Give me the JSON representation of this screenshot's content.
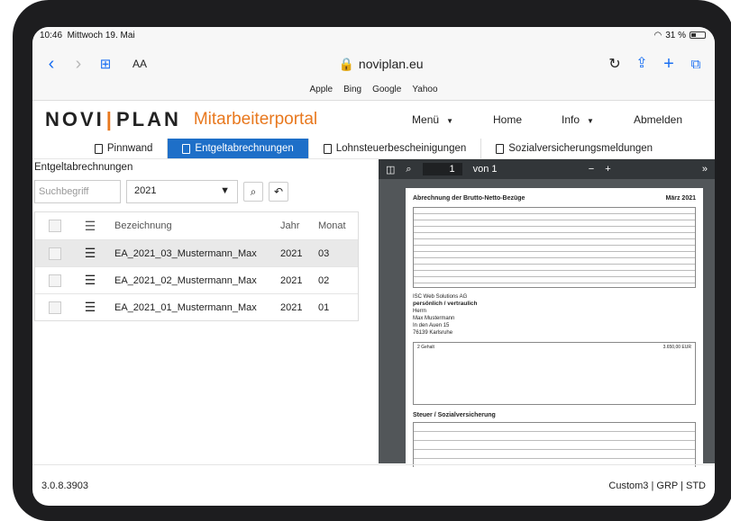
{
  "status": {
    "time": "10:46",
    "date": "Mittwoch 19. Mai",
    "battery": "31 %"
  },
  "safari": {
    "aa": "AA",
    "url": "noviplan.eu",
    "favorites": [
      "Apple",
      "Bing",
      "Google",
      "Yahoo"
    ]
  },
  "app": {
    "logo_a": "NOVI",
    "logo_b": "PLAN",
    "portal": "Mitarbeiterportal",
    "menu": [
      "Menü",
      "Home",
      "Info",
      "Abmelden"
    ]
  },
  "tabs": [
    "Pinnwand",
    "Entgeltabrechnungen",
    "Lohnsteuerbescheinigungen",
    "Sozialversicherungsmeldungen"
  ],
  "list": {
    "title": "Entgeltabrechnungen",
    "search_placeholder": "Suchbegriff",
    "year": "2021",
    "headers": {
      "name": "Bezeichnung",
      "year": "Jahr",
      "month": "Monat"
    },
    "rows": [
      {
        "name": "EA_2021_03_Mustermann_Max",
        "year": "2021",
        "month": "03"
      },
      {
        "name": "EA_2021_02_Mustermann_Max",
        "year": "2021",
        "month": "02"
      },
      {
        "name": "EA_2021_01_Mustermann_Max",
        "year": "2021",
        "month": "01"
      }
    ]
  },
  "viewer": {
    "page": "1",
    "of": "von 1",
    "doc_title": "Abrechnung der Brutto-Netto-Bezüge",
    "doc_date": "März 2021",
    "company": "ISC Web Solutions AG",
    "conf": "persönlich / vertraulich",
    "salutation": "Herrn",
    "name": "Max Mustermann",
    "street": "In den Auen 15",
    "city": "76139 Karlsruhe",
    "pos": "2 Gehalt",
    "amount": "3.650,00 EUR",
    "steuer": "Steuer / Sozialversicherung"
  },
  "footer": {
    "version": "3.0.8.3903",
    "info": "Custom3 | GRP | STD"
  }
}
